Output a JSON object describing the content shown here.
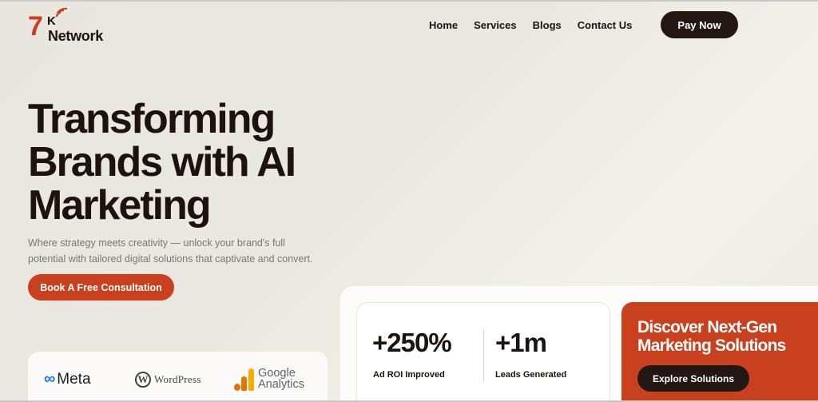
{
  "logo": {
    "number": "7",
    "letter": "K",
    "name": "Network"
  },
  "nav": {
    "items": [
      {
        "label": "Home"
      },
      {
        "label": "Services"
      },
      {
        "label": "Blogs"
      },
      {
        "label": "Contact Us"
      }
    ],
    "pay_button": "Pay Now"
  },
  "hero": {
    "title": "Transforming Brands with AI Marketing",
    "subtitle": "Where strategy meets creativity — unlock your brand's full potential with tailored digital solutions that captivate and convert.",
    "cta": "Book A Free Consultation"
  },
  "partners": {
    "meta": "Meta",
    "wordpress": "WordPress",
    "google_analytics": "Google Analytics"
  },
  "stats": [
    {
      "value": "+250%",
      "label": "Ad ROI Improved"
    },
    {
      "value": "+1m",
      "label": "Leads Generated"
    }
  ],
  "promo": {
    "title": "Discover Next-Gen Marketing Solutions",
    "button": "Explore Solutions"
  },
  "colors": {
    "accent": "#c8401e",
    "dark": "#241612",
    "background": "#ebe8e1"
  }
}
